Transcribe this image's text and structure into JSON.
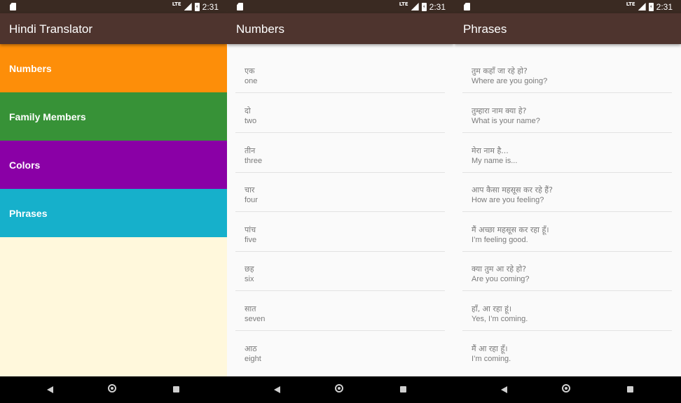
{
  "status_bar": {
    "network": "LTE",
    "time": "2:31"
  },
  "screens": [
    {
      "title": "Hindi Translator",
      "categories": [
        {
          "label": "Numbers",
          "color": "#fd8e09"
        },
        {
          "label": "Family Members",
          "color": "#379237"
        },
        {
          "label": "Colors",
          "color": "#8a00a6"
        },
        {
          "label": "Phrases",
          "color": "#16b0cb"
        }
      ],
      "background": "#fff8dc"
    },
    {
      "title": "Numbers",
      "words": [
        {
          "hindi": "एक",
          "english": "one"
        },
        {
          "hindi": "दो",
          "english": "two"
        },
        {
          "hindi": "तीन",
          "english": "three"
        },
        {
          "hindi": "चार",
          "english": "four"
        },
        {
          "hindi": "पांच",
          "english": "five"
        },
        {
          "hindi": "छह",
          "english": "six"
        },
        {
          "hindi": "सात",
          "english": "seven"
        },
        {
          "hindi": "आठ",
          "english": "eight"
        }
      ]
    },
    {
      "title": "Phrases",
      "words": [
        {
          "hindi": "तुम कहाँ जा रहे हो?",
          "english": "Where are you going?"
        },
        {
          "hindi": "तुम्हारा नाम क्या हे?",
          "english": "What is your name?"
        },
        {
          "hindi": "मेरा नाम है...",
          "english": "My name is..."
        },
        {
          "hindi": "आप कैसा महसूस कर रहे हैं?",
          "english": "How are you feeling?"
        },
        {
          "hindi": "मैं अच्छा महसूस कर रहा हूँ।",
          "english": "I’m feeling good."
        },
        {
          "hindi": "क्या तुम आ रहे हो?",
          "english": "Are you coming?"
        },
        {
          "hindi": "हाँ, आ रहा हूं।",
          "english": "Yes, I’m coming."
        },
        {
          "hindi": "मैं आ रहा हूँ।",
          "english": "I’m coming."
        }
      ]
    }
  ],
  "colors": {
    "app_bar": "#4e342e",
    "status_bar": "#3a2a22",
    "nav_bar": "#000000"
  },
  "icons": {
    "status_left": "sd-card-icon",
    "signal": "signal-icon",
    "battery": "battery-charging-icon",
    "nav": [
      "back-icon",
      "home-icon",
      "recents-icon"
    ]
  }
}
